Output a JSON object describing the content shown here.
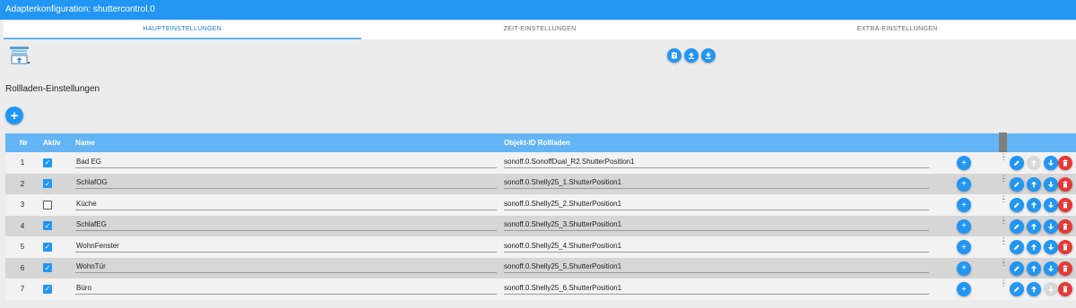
{
  "window": {
    "title": "Adapterkonfiguration: shuttercontrol.0"
  },
  "tabs": [
    {
      "label": "HAUPTEINSTELLUNGEN",
      "active": true
    },
    {
      "label": "ZEIT-EINSTELLUNGEN",
      "active": false
    },
    {
      "label": "EXTRA-EINSTELLUNGEN",
      "active": false
    }
  ],
  "toolbar": {
    "help_icon": "help-icon",
    "upload_icon": "upload-icon",
    "download_icon": "download-icon"
  },
  "section": {
    "title": "Rollladen-Einstellungen",
    "add_label": "+"
  },
  "table": {
    "headers": {
      "nr": "Nr",
      "active": "Aktiv",
      "name": "Name",
      "object_id": "Objekt-ID Rollladen"
    },
    "rows": [
      {
        "nr": "1",
        "active": true,
        "name": "Bad EG",
        "object_id": "sonoff.0.SonoffDual_R2.ShutterPosition1"
      },
      {
        "nr": "2",
        "active": true,
        "name": "SchlafOG",
        "object_id": "sonoff.0.Shelly25_1.ShutterPosition1"
      },
      {
        "nr": "3",
        "active": false,
        "name": "Küche",
        "object_id": "sonoff.0.Shelly25_2.ShutterPosition1"
      },
      {
        "nr": "4",
        "active": true,
        "name": "SchlafEG",
        "object_id": "sonoff.0.Shelly25_3.ShutterPosition1"
      },
      {
        "nr": "5",
        "active": true,
        "name": "WohnFenster",
        "object_id": "sonoff.0.Shelly25_4.ShutterPosition1"
      },
      {
        "nr": "6",
        "active": true,
        "name": "WohnTür",
        "object_id": "sonoff.0.Shelly25_5.ShutterPosition1"
      },
      {
        "nr": "7",
        "active": true,
        "name": "Büro",
        "object_id": "sonoff.0.Shelly25_6.ShutterPosition1"
      }
    ]
  },
  "colors": {
    "accent": "#2196f3",
    "header": "#64b5f6",
    "delete": "#e53935",
    "disabled": "#d8d8d8"
  }
}
